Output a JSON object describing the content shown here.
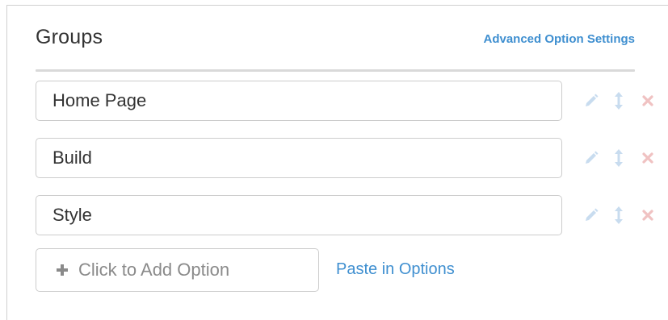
{
  "section": {
    "title": "Groups",
    "advanced_link": "Advanced Option Settings"
  },
  "options": [
    {
      "label": "Home Page"
    },
    {
      "label": "Build"
    },
    {
      "label": "Style"
    }
  ],
  "add_option": {
    "placeholder": "Click to Add Option",
    "icon": "plus-icon"
  },
  "paste_link": "Paste in Options",
  "row_icons": {
    "edit": "pencil-icon",
    "move": "vertical-arrows-icon",
    "delete": "close-x-icon"
  },
  "colors": {
    "link": "#3f8fd0",
    "icon_edit": "#c8dcef",
    "icon_delete": "#f0c2c2",
    "text": "#333333",
    "placeholder": "#8a8a8a",
    "border": "#cccccc"
  }
}
